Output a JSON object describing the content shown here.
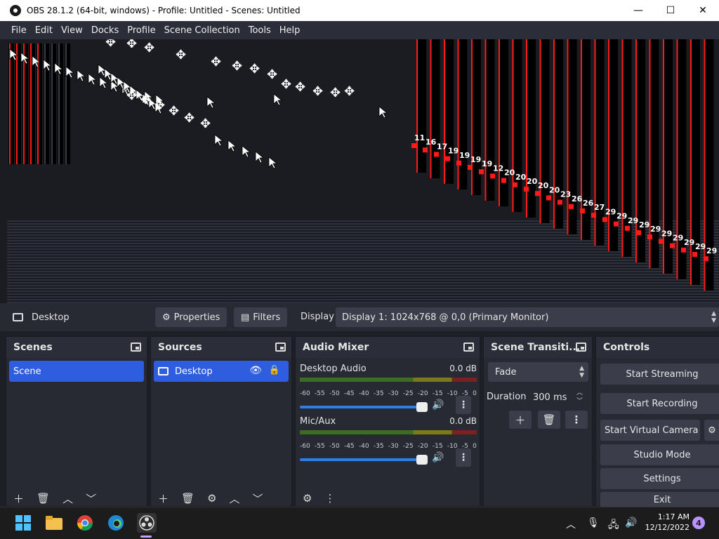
{
  "window": {
    "title": "OBS 28.1.2 (64-bit, windows) - Profile: Untitled - Scenes: Untitled",
    "minimize": "—",
    "maximize": "☐",
    "close": "✕"
  },
  "menu": [
    "File",
    "Edit",
    "View",
    "Docks",
    "Profile",
    "Scene Collection",
    "Tools",
    "Help"
  ],
  "preview": {
    "recursive_labels": [
      "11",
      "16",
      "17",
      "19",
      "19",
      "19",
      "19",
      "12",
      "20",
      "20",
      "20",
      "20",
      "20",
      "23",
      "26",
      "26",
      "27",
      "29",
      "29",
      "29",
      "29",
      "29",
      "29",
      "29",
      "29",
      "29",
      "29"
    ]
  },
  "source_toolbar": {
    "source_name": "Desktop",
    "properties_label": "Properties",
    "filters_label": "Filters",
    "display_label": "Display",
    "display_value": "Display 1: 1024x768 @ 0,0 (Primary Monitor)"
  },
  "scenes": {
    "title": "Scenes",
    "items": [
      "Scene"
    ]
  },
  "sources": {
    "title": "Sources",
    "items": [
      "Desktop"
    ]
  },
  "audio_mixer": {
    "title": "Audio Mixer",
    "channels": [
      {
        "name": "Desktop Audio",
        "db": "0.0 dB",
        "volume": 1.0
      },
      {
        "name": "Mic/Aux",
        "db": "0.0 dB",
        "volume": 1.0
      }
    ],
    "ticks": [
      "-60",
      "-55",
      "-50",
      "-45",
      "-40",
      "-35",
      "-30",
      "-25",
      "-20",
      "-15",
      "-10",
      "-5",
      "0"
    ]
  },
  "transitions": {
    "title": "Scene Transiti...",
    "selected": "Fade",
    "duration_label": "Duration",
    "duration_value": "300 ms"
  },
  "controls": {
    "title": "Controls",
    "start_streaming": "Start Streaming",
    "start_recording": "Start Recording",
    "start_virtual_camera": "Start Virtual Camera",
    "studio_mode": "Studio Mode",
    "settings": "Settings",
    "exit": "Exit"
  },
  "taskbar": {
    "time": "1:17 AM",
    "date": "12/12/2022",
    "notifications": "4"
  },
  "colors": {
    "accent": "#2f5de0",
    "panel": "#272a33",
    "preview_red": "#ff1a1a"
  }
}
